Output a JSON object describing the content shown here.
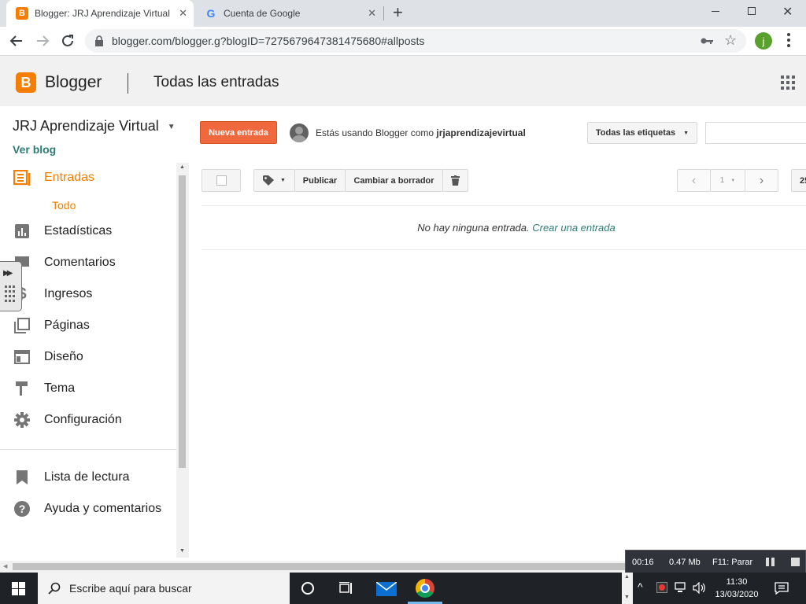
{
  "browser": {
    "tabs": [
      {
        "title": "Blogger: JRJ Aprendizaje Virtual",
        "favicon": "blogger-favicon",
        "active": true
      },
      {
        "title": "Cuenta de Google",
        "favicon": "google-favicon",
        "active": false
      }
    ],
    "url": "blogger.com/blogger.g?blogID=7275679647381475680#allposts",
    "new_tab_glyph": "+",
    "close_glyph": "✕",
    "profile_initial": "j"
  },
  "header": {
    "logo_letter": "B",
    "brand": "Blogger",
    "page_title": "Todas las entradas"
  },
  "blog": {
    "name": "JRJ Aprendizaje Virtual",
    "view_blog": "Ver blog"
  },
  "sidebar": {
    "items": [
      {
        "label": "Entradas",
        "icon": "posts-icon",
        "active": true
      },
      {
        "label": "Todo",
        "sub": true
      },
      {
        "label": "Estadísticas",
        "icon": "stats-icon"
      },
      {
        "label": "Comentarios",
        "icon": "comments-icon"
      },
      {
        "label": "Ingresos",
        "icon": "earnings-icon"
      },
      {
        "label": "Páginas",
        "icon": "pages-icon"
      },
      {
        "label": "Diseño",
        "icon": "layout-icon"
      },
      {
        "label": "Tema",
        "icon": "theme-icon"
      },
      {
        "label": "Configuración",
        "icon": "settings-icon"
      },
      {
        "label": "Lista de lectura",
        "icon": "reading-list-icon"
      },
      {
        "label": "Ayuda y comentarios",
        "icon": "help-icon"
      }
    ]
  },
  "actions": {
    "new_post": "Nueva entrada",
    "using_as_prefix": "Estás usando Blogger como ",
    "using_as_user": "jrjaprendizajevirtual",
    "labels_dropdown": "Todas las etiquetas",
    "search_placeholder": ""
  },
  "post_toolbar": {
    "publish": "Publicar",
    "revert_draft": "Cambiar a borrador",
    "page": "1",
    "per_page": "25"
  },
  "empty": {
    "message": "No hay ninguna entrada. ",
    "link": "Crear una entrada"
  },
  "recorder": {
    "time": "00:16",
    "size": "0.47 Mb",
    "stop_hint": "F11: Parar"
  },
  "taskbar": {
    "search_placeholder": "Escribe aquí para buscar",
    "time": "11:30",
    "date": "13/03/2020"
  },
  "colors": {
    "accent": "#f57d00",
    "new_post_button": "#f0693e",
    "link": "#2a7d74"
  }
}
